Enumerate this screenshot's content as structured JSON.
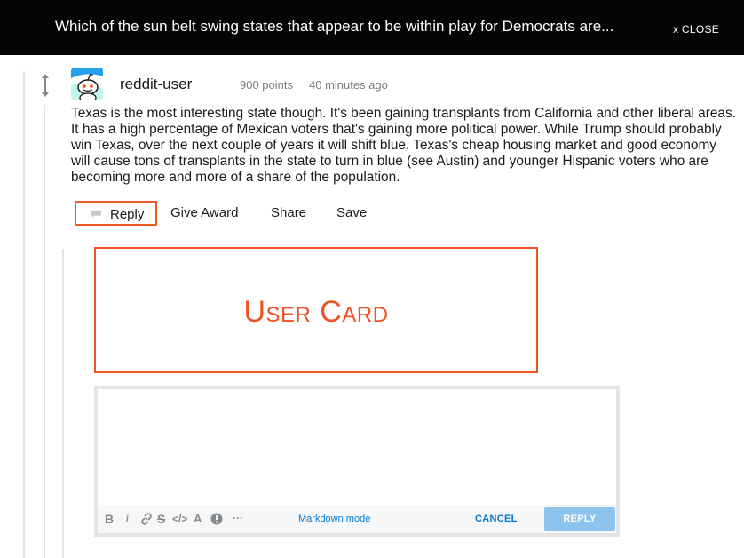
{
  "topbar": {
    "title": "Which of the sun belt swing states that appear to be within play for Democrats are...",
    "close_label": "x  CLOSE"
  },
  "comment": {
    "username": "reddit-user",
    "points": "900 points",
    "time": "40 minutes ago",
    "body": "Texas is the most interesting state though. It's been gaining transplants from California and other liberal areas. It has a high percentage of Mexican voters that's gaining more political power. While Trump should probably win Texas, over the next couple of years it will shift blue. Texas's cheap housing market and good economy will cause tons of transplants in the state to turn in blue (see Austin) and younger Hispanic voters who are becoming more and more of a share of the population."
  },
  "actions": {
    "reply": "Reply",
    "give_award": "Give Award",
    "share": "Share",
    "save": "Save"
  },
  "user_card": {
    "label": "User Card"
  },
  "editor": {
    "toolbar": {
      "bold": "B",
      "italic": "i",
      "link": "🔗",
      "strike": "S",
      "code": "</>",
      "superscript": "A",
      "spoiler": "!",
      "more": "···"
    },
    "markdown_mode": "Markdown mode",
    "cancel": "CANCEL",
    "reply": "REPLY"
  },
  "colors": {
    "highlight": "#ef5323",
    "link_blue": "#0079d3",
    "reply_button": "#8ec3ee"
  }
}
